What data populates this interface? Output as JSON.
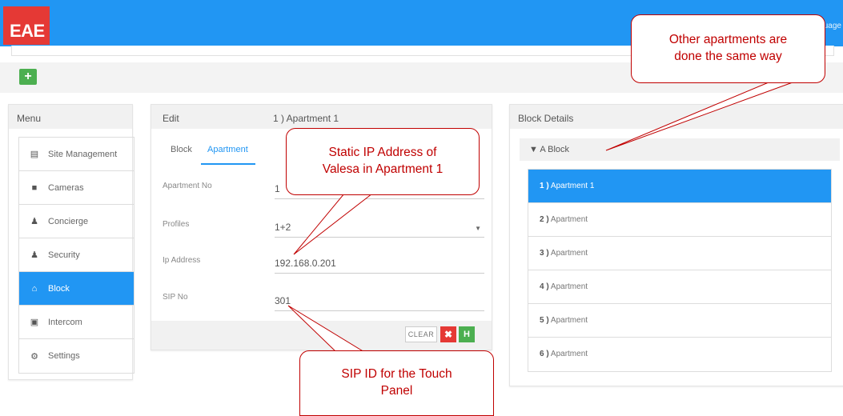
{
  "header": {
    "logo_text": "EAE",
    "language_text": "uage",
    "brand_color": "#2196f3",
    "logo_color": "#e53935"
  },
  "toolbar": {
    "add_label": "+"
  },
  "menu": {
    "title": "Menu",
    "items": [
      {
        "label": "Site Management",
        "icon": "list-icon"
      },
      {
        "label": "Cameras",
        "icon": "camera-icon"
      },
      {
        "label": "Concierge",
        "icon": "user-icon"
      },
      {
        "label": "Security",
        "icon": "user-icon"
      },
      {
        "label": "Block",
        "icon": "home-icon",
        "active": true
      },
      {
        "label": "Intercom",
        "icon": "intercom-icon"
      },
      {
        "label": "Settings",
        "icon": "gear-icon"
      }
    ]
  },
  "edit": {
    "title": "Edit",
    "subtitle": "1 ) Apartment 1",
    "tabs": [
      {
        "label": "Block"
      },
      {
        "label": "Apartment",
        "active": true
      }
    ],
    "fields": [
      {
        "label": "Apartment No",
        "value": "1"
      },
      {
        "label": "Profiles",
        "value": "1+2"
      },
      {
        "label": "Ip Address",
        "value": "192.168.0.201"
      },
      {
        "label": "SIP No",
        "value": "301"
      }
    ],
    "clear_label": "CLEAR",
    "cancel_symbol": "✖",
    "save_symbol": "H"
  },
  "block_details": {
    "title": "Block Details",
    "block_name": "A Block",
    "apartments": [
      {
        "num": "1 )",
        "name": "Apartment 1",
        "active": true
      },
      {
        "num": "2 )",
        "name": "Apartment"
      },
      {
        "num": "3 )",
        "name": "Apartment"
      },
      {
        "num": "4 )",
        "name": "Apartment"
      },
      {
        "num": "5 )",
        "name": "Apartment"
      },
      {
        "num": "6 )",
        "name": "Apartment"
      }
    ]
  },
  "callouts": {
    "other_apartments": {
      "line1": "Other apartments are",
      "line2": "done the same way"
    },
    "static_ip": {
      "line1": "Static IP Address of",
      "line2": "Valesa in Apartment 1"
    },
    "sip_id": {
      "line1": "SIP ID for the Touch",
      "line2": "Panel"
    },
    "color": "#c00000"
  }
}
